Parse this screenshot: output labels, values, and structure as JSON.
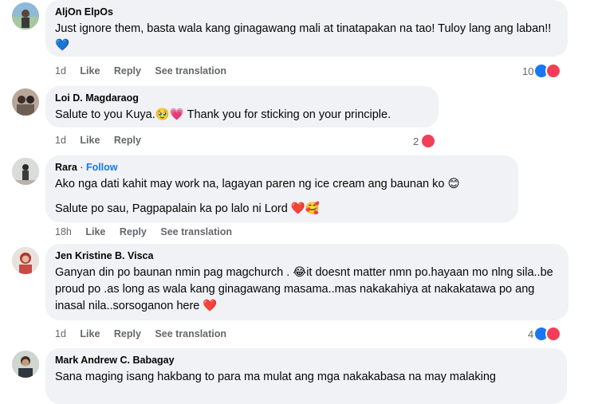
{
  "comments": [
    {
      "author": "AljOn ElpOs",
      "text": "Just ignore them, basta wala kang ginagawang mali at tinatapakan na tao! Tuloy lang ang laban!!💙",
      "time": "1d",
      "like": "Like",
      "reply": "Reply",
      "translate": "See translation",
      "reaction_count": "10"
    },
    {
      "author": "Loi D. Magdaraog",
      "text": "Salute to you Kuya.🥹💗 Thank you for sticking on your principle.",
      "time": "1d",
      "like": "Like",
      "reply": "Reply",
      "reaction_count": "2"
    },
    {
      "author": "Rara",
      "separator": "·",
      "follow": "Follow",
      "text": "Ako nga dati kahit may work na, lagayan paren ng ice cream ang baunan ko 😊",
      "text2": "Salute po sau, Pagpapalain ka po lalo ni Lord ❤️🥰",
      "time": "18h",
      "like": "Like",
      "reply": "Reply",
      "translate": "See translation"
    },
    {
      "author": "Jen Kristine B. Visca",
      "text": "Ganyan din po baunan nmin pag magchurch . 😂it doesnt matter nmn po.hayaan mo nlng sila..be proud po .as long as wala kang ginagawang masama..mas nakakahiya at nakakatawa po ang inasal nila..sorsoganon here ❤️",
      "time": "1d",
      "like": "Like",
      "reply": "Reply",
      "translate": "See translation",
      "reaction_count": "4"
    },
    {
      "author": "Mark Andrew C. Babagay",
      "text": "Sana maging isang hakbang to para ma mulat ang mga nakakabasa na may malaking"
    }
  ],
  "colors": {
    "like": "#1877f2",
    "love": "#f33e58",
    "bubble": "#f0f2f5",
    "meta": "#65676b"
  }
}
